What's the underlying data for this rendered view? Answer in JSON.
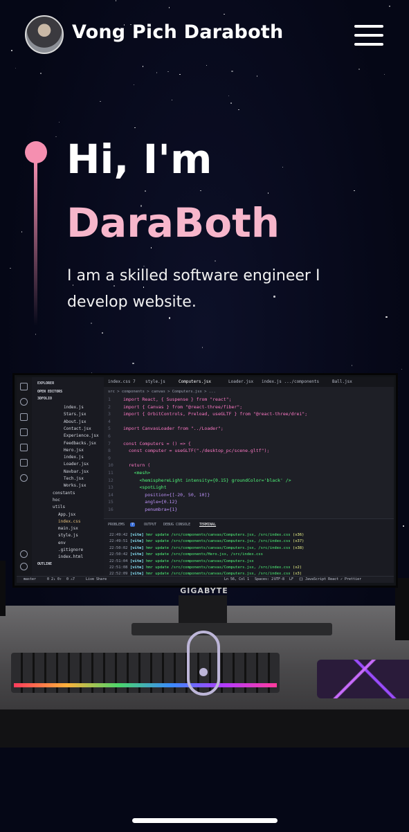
{
  "header": {
    "brand_name": "Vong Pich Daraboth",
    "avatar_icon": "profile-photo",
    "menu_icon": "hamburger-menu-icon"
  },
  "hero": {
    "greeting": "Hi, I'm",
    "name": "DaraBoth",
    "subtitle": "I am a skilled software engineer I develop website."
  },
  "scene": {
    "monitor_brand": "GIGABYTE",
    "scroll_icon": "mouse-scroll-indicator"
  },
  "editor": {
    "explorer_title": "EXPLORER",
    "open_editors": "OPEN EDITORS",
    "folder": "3DFOLIO",
    "files": [
      "index.js",
      "Stars.jsx",
      "About.jsx",
      "Contact.jsx",
      "Experience.jsx",
      "Feedbacks.jsx",
      "Hero.jsx",
      "index.js",
      "Loader.jsx",
      "Navbar.jsx",
      "Tech.jsx",
      "Works.jsx",
      "constants",
      "hoc",
      "utils",
      "App.jsx",
      "index.css",
      "main.jsx",
      "style.js",
      "env",
      ".gitignore",
      "index.html",
      "OUTLINE"
    ],
    "tabs": [
      "index.css 7",
      "style.js",
      "Computers.jsx",
      "Loader.jsx",
      "index.js .../components",
      "Ball.jsx"
    ],
    "breadcrumb": "src > components > canvas > Computers.jsx > ...",
    "code": [
      {
        "n": "1",
        "t": "import React, { Suspense } from \"react\";"
      },
      {
        "n": "2",
        "t": "import { Canvas } from \"@react-three/fiber\";"
      },
      {
        "n": "3",
        "t": "import { OrbitControls, Preload, useGLTF } from \"@react-three/drei\";"
      },
      {
        "n": "4",
        "t": ""
      },
      {
        "n": "5",
        "t": "import CanvasLoader from \"../Loader\";"
      },
      {
        "n": "6",
        "t": ""
      },
      {
        "n": "7",
        "t": "const Computers = () => {"
      },
      {
        "n": "8",
        "t": "  const computer = useGLTF(\"./desktop_pc/scene.gltf\");"
      },
      {
        "n": "9",
        "t": ""
      },
      {
        "n": "10",
        "t": "  return ("
      },
      {
        "n": "11",
        "t": "    <mesh>"
      },
      {
        "n": "12",
        "t": "      <hemisphereLight intensity={0.15} groundColor='black' />"
      },
      {
        "n": "13",
        "t": "      <spotLight"
      },
      {
        "n": "14",
        "t": "        position={[-20, 50, 10]}"
      },
      {
        "n": "15",
        "t": "        angle={0.12}"
      },
      {
        "n": "16",
        "t": "        penumbra={1}"
      }
    ],
    "panel_tabs": [
      "PROBLEMS",
      "OUTPUT",
      "DEBUG CONSOLE",
      "TERMINAL"
    ],
    "problems_count": "7",
    "terminal_lines": [
      {
        "time": "22:49:42",
        "msg": "hmr update /src/components/canvas/Computers.jsx, /src/index.css",
        "count": "(x36)"
      },
      {
        "time": "22:49:51",
        "msg": "hmr update /src/components/canvas/Computers.jsx, /src/index.css",
        "count": "(x37)"
      },
      {
        "time": "22:50:02",
        "msg": "hmr update /src/components/canvas/Computers.jsx, /src/index.css",
        "count": "(x38)"
      },
      {
        "time": "22:50:42",
        "msg": "hmr update /src/components/Hero.jsx, /src/index.css",
        "count": ""
      },
      {
        "time": "22:51:04",
        "msg": "hmr update /src/components/canvas/Computers.jsx",
        "count": ""
      },
      {
        "time": "22:51:08",
        "msg": "hmr update /src/components/canvas/Computers.jsx, /src/index.css",
        "count": "(x2)"
      },
      {
        "time": "22:52:09",
        "msg": "hmr update /src/components/canvas/Computers.jsx, /src/index.css",
        "count": "(x3)"
      }
    ],
    "terminal_tag": "[vite]",
    "status_left": [
      "master",
      "0 2↓ 0↑",
      "0 ⚠7",
      "Live Share"
    ],
    "status_right": [
      "Ln 56, Col 1",
      "Spaces: 2",
      "UTF-8",
      "LF",
      "{} JavaScript React",
      "✓ Prettier"
    ]
  },
  "colors": {
    "background": "#070a1c",
    "accent_pink": "#f7b6cb",
    "accent_dot": "#f58fb0",
    "text_white": "#ffffff"
  }
}
